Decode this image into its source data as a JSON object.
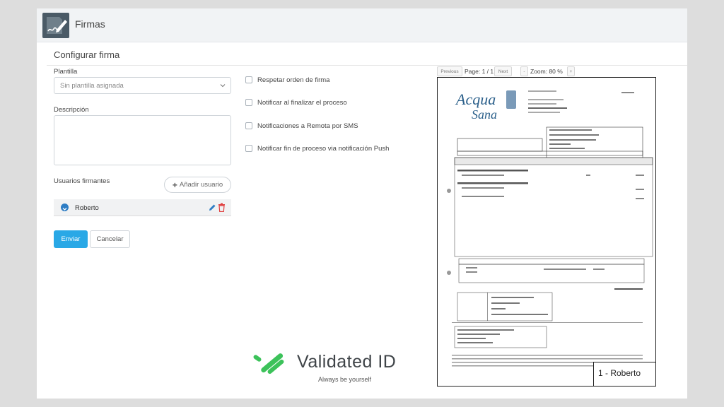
{
  "header": {
    "title": "Firmas",
    "icon": "signature-edit-icon"
  },
  "section": {
    "title": "Configurar firma"
  },
  "form": {
    "template_label": "Plantilla",
    "template_value": "Sin plantilla asignada",
    "description_label": "Descripción",
    "description_value": "",
    "signers_label": "Usuarios firmantes",
    "add_user_label": "Añadir usuario",
    "signers": [
      {
        "name": "Roberto"
      }
    ],
    "options": [
      {
        "label": "Respetar orden de firma",
        "checked": false
      },
      {
        "label": "Notificar al finalizar el proceso",
        "checked": false
      },
      {
        "label": "Notificaciones a Remota por SMS",
        "checked": false
      },
      {
        "label": "Notificar fin de proceso via notificación Push",
        "checked": false
      }
    ],
    "send_label": "Enviar",
    "cancel_label": "Cancelar"
  },
  "viewer": {
    "previous_label": "Previous",
    "page_label": "Page: 1 / 1",
    "next_label": "Next",
    "zoom_out_label": "-",
    "zoom_label": "Zoom: 80 %",
    "zoom_in_label": "+",
    "signature_stamp": "1 - Roberto",
    "doc_logo_text": "AcquaSana"
  },
  "brand": {
    "name": "Validated ID",
    "tagline": "Always be yourself",
    "accent": "#29a8e6",
    "logo_green": "#3cc25a"
  }
}
